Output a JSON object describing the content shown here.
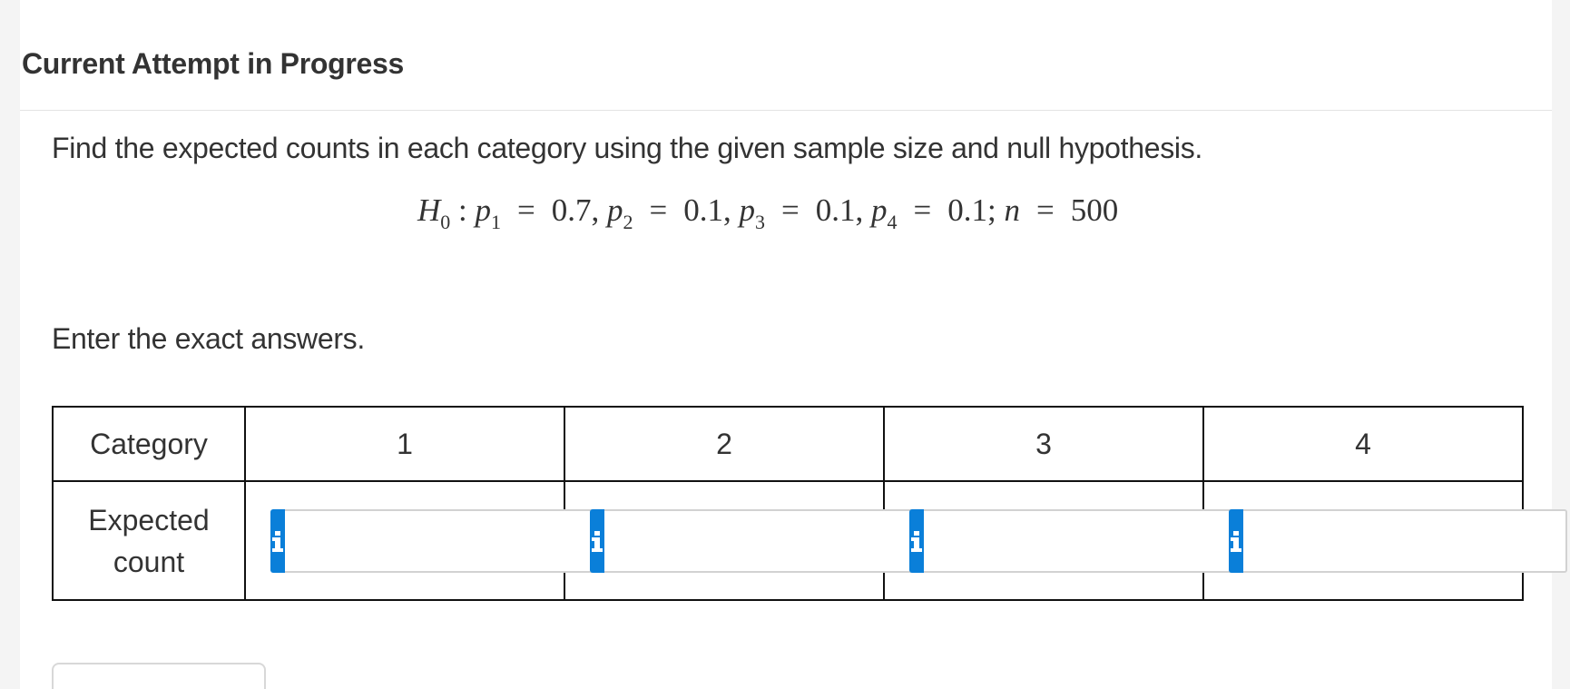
{
  "header": {
    "title": "Current Attempt in Progress"
  },
  "question": {
    "instructions": "Find the expected counts in each category using the given sample size and null hypothesis.",
    "formula": {
      "hypothesis_symbol": "H",
      "hypothesis_sub": "0",
      "p_symbol": "p",
      "p1": "0.7",
      "p2": "0.1",
      "p3": "0.1",
      "p4": "0.1",
      "n_symbol": "n",
      "n": "500"
    },
    "answer_note": "Enter the exact answers."
  },
  "table": {
    "header_label": "Category",
    "categories": [
      "1",
      "2",
      "3",
      "4"
    ],
    "row_label_line1": "Expected",
    "row_label_line2": "count",
    "inputs": [
      {
        "value": "",
        "icon": "info-icon"
      },
      {
        "value": "",
        "icon": "info-icon"
      },
      {
        "value": "",
        "icon": "info-icon"
      },
      {
        "value": "",
        "icon": "info-icon"
      }
    ]
  },
  "colors": {
    "info_button": "#0a7fd9",
    "text": "#333333",
    "table_border": "#111111"
  }
}
